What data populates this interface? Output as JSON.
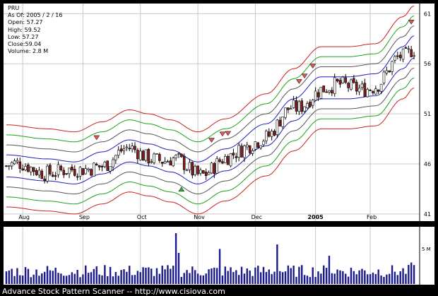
{
  "chart_data": {
    "type": "candlestick",
    "ticker": "PRU",
    "as_of": "As Of: 2005 / 2 / 16",
    "stats": {
      "open": "Open: 57.27",
      "high": "High: 59.52",
      "low": "Low: 57.27",
      "close": "Close:59.04",
      "volume": "Volume: 2.8 M"
    },
    "ylim": [
      40.5,
      61.8
    ],
    "y_ticks": [
      41,
      46,
      51,
      56,
      61
    ],
    "x_tick_labels": [
      "Aug",
      "Sep",
      "Oct",
      "Nov",
      "Dec",
      "2005",
      "Feb"
    ],
    "volume_tick_label": "5 M",
    "n_days": 150,
    "trend_anchors": {
      "day": [
        0,
        15,
        25,
        35,
        45,
        52,
        60,
        70,
        80,
        95,
        105,
        115,
        125,
        135,
        145,
        149
      ],
      "price": [
        45.8,
        45.4,
        45.1,
        46.1,
        47.3,
        46.9,
        46.3,
        45.1,
        46.4,
        48.9,
        51.4,
        53.6,
        53.6,
        53.9,
        56.6,
        57.7
      ]
    },
    "envelope_offsets": {
      "blue": 1.1,
      "gray": 2.1,
      "green": 3.1,
      "red": 4.1
    },
    "colors": {
      "background": "#ffffff",
      "frame": "#000000",
      "grid": "#c8c8c8",
      "red_band": "#cc1f1f",
      "green_band": "#1aa21a",
      "blue_band": "#1f1fbb",
      "gray_band": "#555555",
      "down_candle": "#8c1d1d",
      "up_candle": "#ffffff",
      "volume": "#1a1a8c",
      "marker_down": "#e05555",
      "marker_up": "#33aa33"
    }
  },
  "footer": "Advance Stock Pattern Scanner -- http://www.cisiova.com"
}
